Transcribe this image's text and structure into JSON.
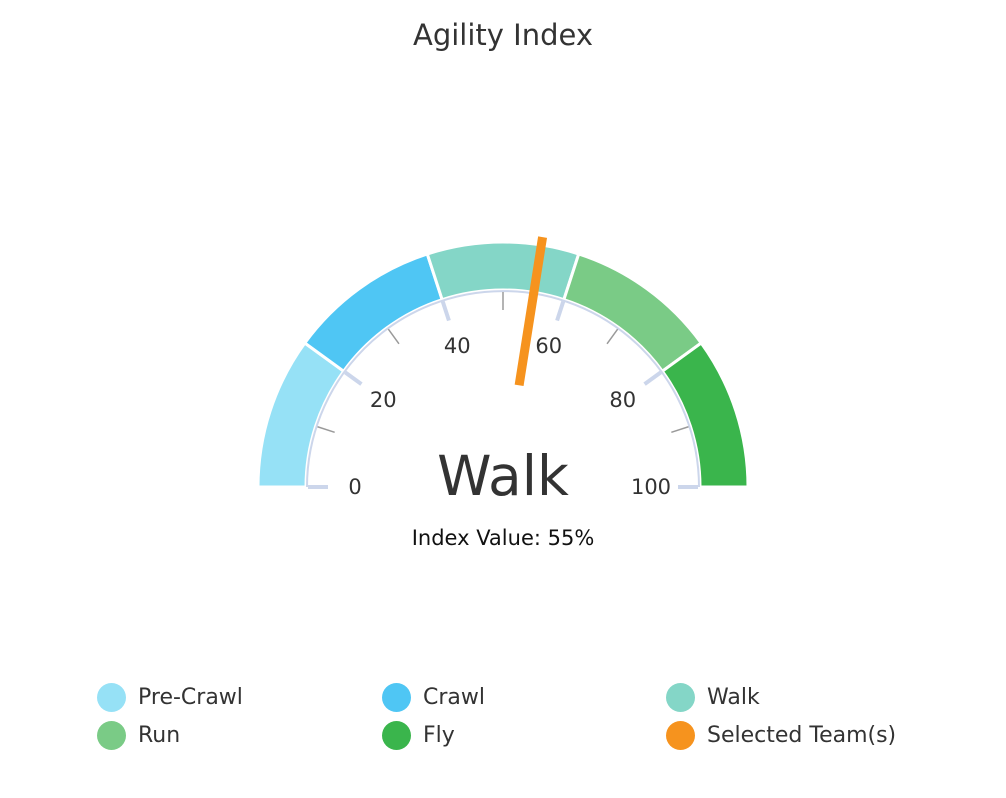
{
  "chart_data": {
    "type": "gauge",
    "title": "Agility Index",
    "min": 0,
    "max": 100,
    "tick_labels": [
      "0",
      "20",
      "40",
      "60",
      "80",
      "100"
    ],
    "bands": [
      {
        "name": "Pre-Crawl",
        "from": 0,
        "to": 20,
        "color": "#96e1f6"
      },
      {
        "name": "Crawl",
        "from": 20,
        "to": 40,
        "color": "#4fc6f4"
      },
      {
        "name": "Walk",
        "from": 40,
        "to": 60,
        "color": "#84d6c7"
      },
      {
        "name": "Run",
        "from": 60,
        "to": 80,
        "color": "#7acb86"
      },
      {
        "name": "Fly",
        "from": 80,
        "to": 100,
        "color": "#3ab54c"
      }
    ],
    "value": 55,
    "pointer_name": "Selected Team(s)",
    "pointer_color": "#f6931e",
    "center_label": "Walk",
    "value_label": "Index Value: 55%"
  },
  "legend": [
    {
      "label": "Pre-Crawl",
      "color": "#96e1f6"
    },
    {
      "label": "Crawl",
      "color": "#4fc6f4"
    },
    {
      "label": "Walk",
      "color": "#84d6c7"
    },
    {
      "label": "Run",
      "color": "#7acb86"
    },
    {
      "label": "Fly",
      "color": "#3ab54c"
    },
    {
      "label": "Selected Team(s)",
      "color": "#f6931e"
    }
  ]
}
